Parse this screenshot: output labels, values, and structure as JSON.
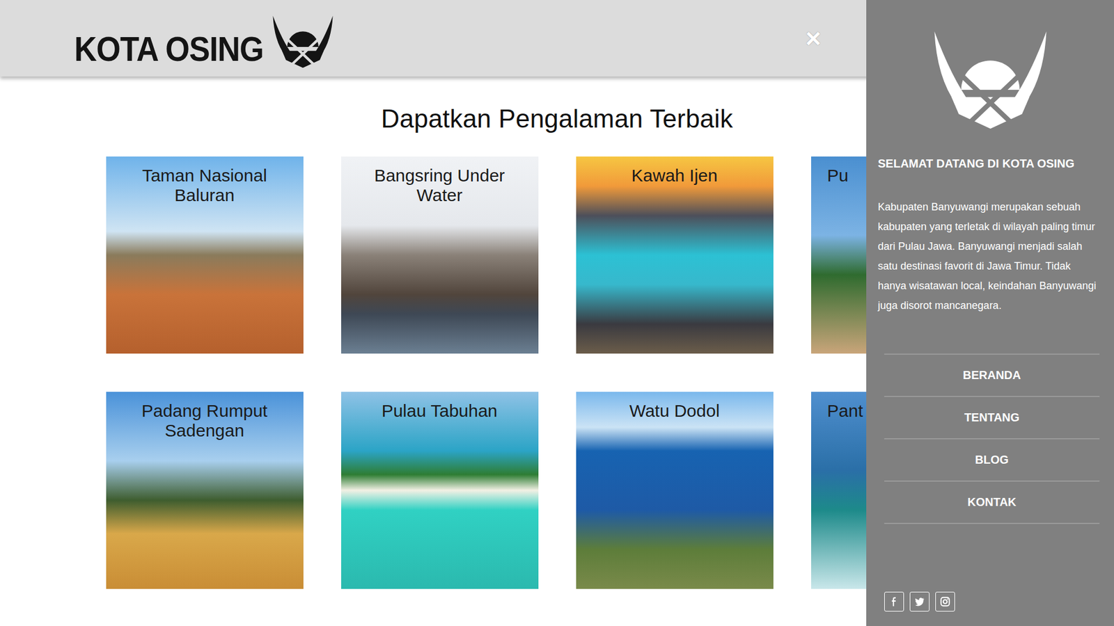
{
  "header": {
    "logo": "KOTA OSING",
    "close": "×"
  },
  "title": "Dapatkan Pengalaman Terbaik",
  "cards": [
    {
      "title": "Taman Nasional Baluran"
    },
    {
      "title": "Bangsring Under Water"
    },
    {
      "title": "Kawah Ijen"
    },
    {
      "title": "Pu"
    },
    {
      "title": "Padang Rumput Sadengan"
    },
    {
      "title": "Pulau Tabuhan"
    },
    {
      "title": "Watu Dodol"
    },
    {
      "title": "Pant"
    }
  ],
  "sidebar": {
    "heading": "SELAMAT DATANG DI KOTA OSING",
    "description": "Kabupaten Banyuwangi merupakan sebuah kabupaten yang terletak di wilayah paling timur dari Pulau Jawa. Banyuwangi menjadi salah satu destinasi favorit di Jawa Timur. Tidak hanya wisatawan local, keindahan Banyuwangi juga disorot mancanegara.",
    "nav": [
      {
        "label": "BERANDA"
      },
      {
        "label": "TENTANG"
      },
      {
        "label": "BLOG"
      },
      {
        "label": "KONTAK"
      }
    ]
  }
}
